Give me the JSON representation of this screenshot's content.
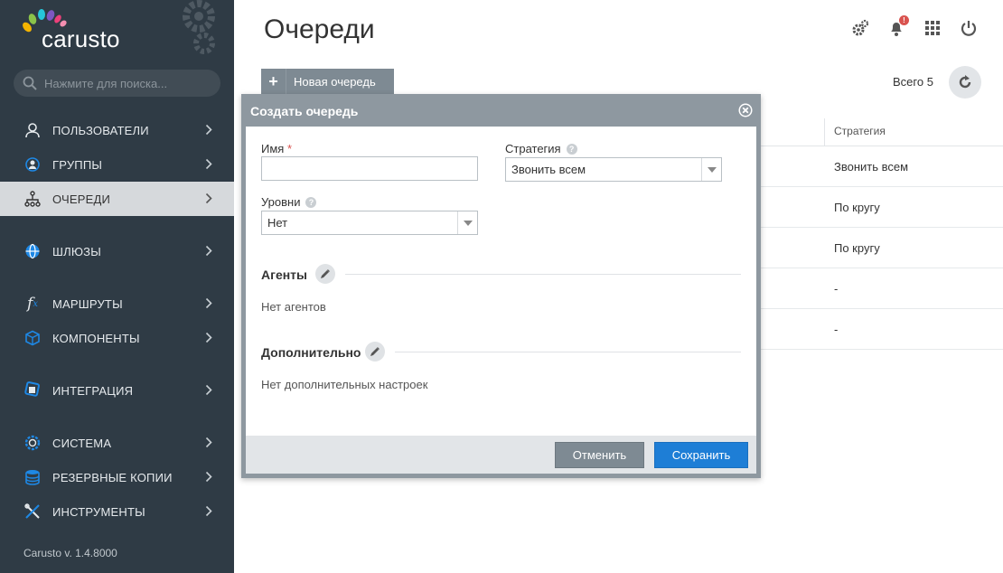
{
  "app": {
    "logo_text": "carusto",
    "version": "Carusto v. 1.4.8000"
  },
  "search": {
    "placeholder": "Нажмите для поиска..."
  },
  "sidebar": {
    "items": [
      {
        "label": "ПОЛЬЗОВАТЕЛИ",
        "icon": "user-icon"
      },
      {
        "label": "ГРУППЫ",
        "icon": "group-icon"
      },
      {
        "label": "ОЧЕРЕДИ",
        "icon": "queue-icon",
        "active": true
      },
      {
        "label": "ШЛЮЗЫ",
        "icon": "globe-icon"
      },
      {
        "label": "МАРШРУТЫ",
        "icon": "function-icon"
      },
      {
        "label": "КОМПОНЕНТЫ",
        "icon": "cube-icon"
      },
      {
        "label": "ИНТЕГРАЦИЯ",
        "icon": "integration-icon"
      },
      {
        "label": "СИСТЕМА",
        "icon": "system-icon"
      },
      {
        "label": "РЕЗЕРВНЫЕ КОПИИ",
        "icon": "database-icon"
      },
      {
        "label": "ИНСТРУМЕНТЫ",
        "icon": "tools-icon"
      }
    ]
  },
  "header": {
    "title": "Очереди",
    "notification_badge": "!"
  },
  "toolbar": {
    "new_queue_label": "Новая очередь",
    "total_label": "Всего 5"
  },
  "table": {
    "column_strategy": "Стратегия",
    "rows": [
      {
        "strategy": "Звонить всем"
      },
      {
        "strategy": "По кругу"
      },
      {
        "strategy": "По кругу"
      },
      {
        "strategy": "-"
      },
      {
        "strategy": "-"
      }
    ]
  },
  "modal": {
    "title": "Создать очередь",
    "name_label": "Имя",
    "name_required": "*",
    "name_value": "",
    "strategy_label": "Стратегия",
    "strategy_value": "Звонить всем",
    "levels_label": "Уровни",
    "levels_value": "Нет",
    "agents_title": "Агенты",
    "agents_empty": "Нет агентов",
    "extra_title": "Дополнительно",
    "extra_empty": "Нет дополнительных настроек",
    "help_glyph": "?",
    "cancel_label": "Отменить",
    "save_label": "Сохранить"
  },
  "colors": {
    "sidebar_bg": "#2f3b45",
    "active_item_bg": "#d6d9dc",
    "primary_button": "#1e7ed6",
    "secondary_button": "#7e8a93",
    "required_star": "#d9534f"
  }
}
